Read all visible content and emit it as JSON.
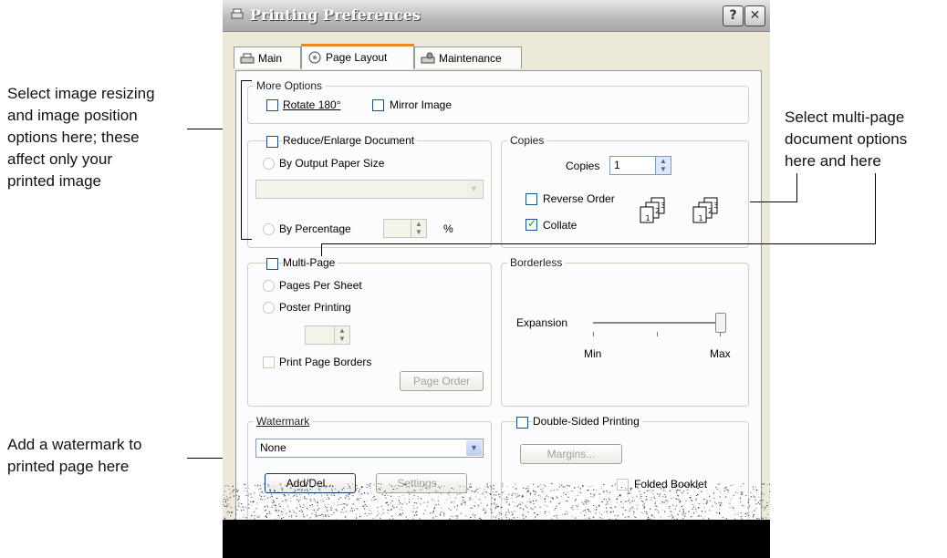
{
  "annotations": {
    "left_top": [
      "Select image resizing",
      "and image position",
      "options here; these",
      "affect only your",
      "printed image"
    ],
    "left_bottom": [
      "Add a watermark to",
      "printed page here"
    ],
    "right": [
      "Select multi-page",
      "document options",
      "here and here"
    ]
  },
  "window": {
    "title": "Printing Preferences",
    "help_button": "?",
    "close_button": "✕"
  },
  "tabs": [
    {
      "label": "Main",
      "icon": "printer-icon"
    },
    {
      "label": "Page Layout",
      "icon": "page-layout-icon"
    },
    {
      "label": "Maintenance",
      "icon": "maintenance-icon"
    }
  ],
  "more_options": {
    "legend": "More Options",
    "rotate": "Rotate 180°",
    "mirror": "Mirror Image"
  },
  "reduce": {
    "label": "Reduce/Enlarge Document",
    "by_paper": "By Output Paper Size",
    "by_percentage": "By Percentage",
    "percent_symbol": "%"
  },
  "copies": {
    "legend": "Copies",
    "label": "Copies",
    "value": "1",
    "reverse": "Reverse Order",
    "collate": "Collate"
  },
  "multi_page": {
    "label": "Multi-Page",
    "pages_per_sheet": "Pages Per Sheet",
    "poster": "Poster Printing",
    "print_borders": "Print Page Borders",
    "page_order": "Page Order"
  },
  "borderless": {
    "legend": "Borderless",
    "expansion": "Expansion",
    "min": "Min",
    "max": "Max"
  },
  "watermark": {
    "legend": "Watermark",
    "value": "None",
    "add_del": "Add/Del...",
    "settings": "Settings..."
  },
  "double_sided": {
    "label": "Double-Sided Printing",
    "margins": "Margins...",
    "folded": "Folded Booklet"
  }
}
